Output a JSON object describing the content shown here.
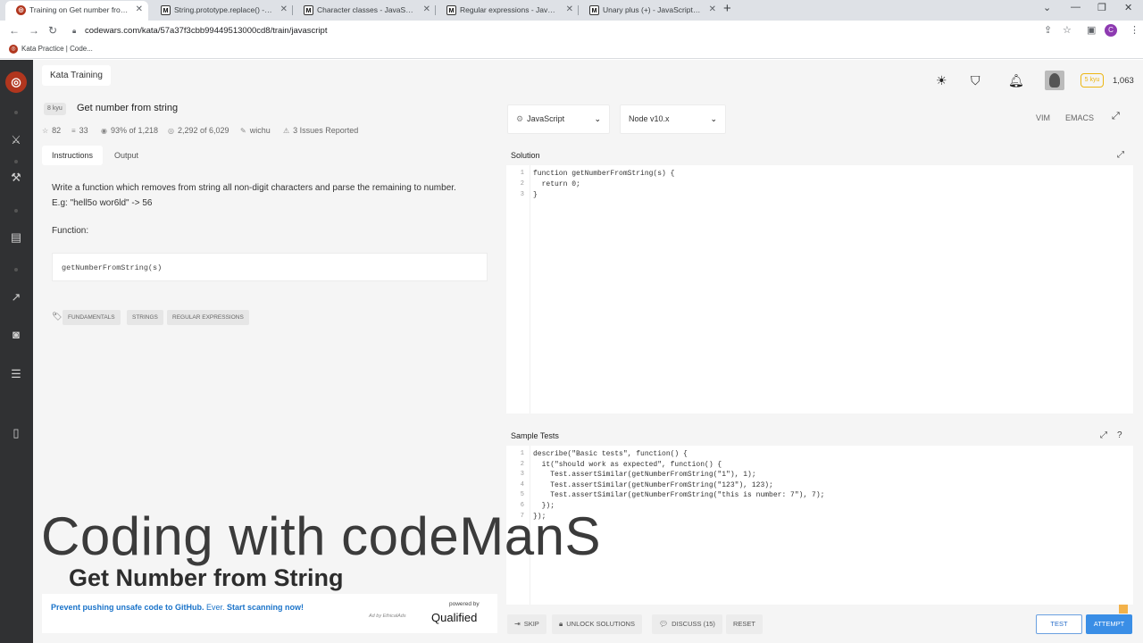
{
  "browser": {
    "tabs": [
      {
        "title": "Training on Get number from str",
        "favicon": "codewars-icon",
        "active": true
      },
      {
        "title": "String.prototype.replace() - JavaS",
        "favicon": "mdn-icon",
        "active": false
      },
      {
        "title": "Character classes - JavaScript | M",
        "favicon": "mdn-icon",
        "active": false
      },
      {
        "title": "Regular expressions - JavaScript",
        "favicon": "mdn-icon",
        "active": false
      },
      {
        "title": "Unary plus (+) - JavaScript | MDN",
        "favicon": "mdn-icon",
        "active": false
      }
    ],
    "url": "codewars.com/kata/57a37f3cbb99449513000cd8/train/javascript",
    "bookmark": "Kata Practice | Code...",
    "profile_initial": "C"
  },
  "breadcrumb": "Kata Training",
  "header": {
    "honor": "1,063",
    "rank_badge": "5 kyu"
  },
  "kata": {
    "rank": "8 kyu",
    "title": "Get number from string",
    "stats": {
      "stars": "82",
      "collections": "33",
      "satisfaction": "93%",
      "satisfaction_of": "of 1,218",
      "completed": "2,292",
      "completed_of": "of 6,029",
      "author": "wichu",
      "issues": "3 Issues Reported"
    },
    "tabs": [
      "Instructions",
      "Output"
    ],
    "description_line1": "Write a function which removes from string all non-digit characters and parse the remaining to number.",
    "description_line2": "E.g: \"hell5o wor6ld\" -> 56",
    "function_label": "Function:",
    "function_signature": "getNumberFromString(s)",
    "tags": [
      "FUNDAMENTALS",
      "STRINGS",
      "REGULAR EXPRESSIONS"
    ]
  },
  "ad": {
    "text_bold1": "Prevent pushing unsafe code to GitHub.",
    "text_normal": " Ever. ",
    "text_bold2": "Start scanning now!",
    "note": "Ad by EthicalAds",
    "powered": "powered by",
    "brand": "Qualified"
  },
  "editor": {
    "language": "JavaScript",
    "runtime": "Node v10.x",
    "mode_vim": "VIM",
    "mode_emacs": "EMACS",
    "solution_title": "Solution",
    "solution_lines": [
      "function getNumberFromString(s) {",
      "  return 0;",
      "}"
    ],
    "tests_title": "Sample Tests",
    "test_lines": [
      "describe(\"Basic tests\", function() {",
      "  it(\"should work as expected\", function() {",
      "    Test.assertSimilar(getNumberFromString(\"1\"), 1);",
      "    Test.assertSimilar(getNumberFromString(\"123\"), 123);",
      "    Test.assertSimilar(getNumberFromString(\"this is number: 7\"), 7);",
      "  });",
      "});"
    ]
  },
  "actions": {
    "skip": "SKIP",
    "unlock": "UNLOCK SOLUTIONS",
    "discuss": "DISCUSS (15)",
    "reset": "RESET",
    "test": "TEST",
    "attempt": "ATTEMPT"
  },
  "overlay": {
    "title": "Coding with codeManS",
    "subtitle": "Get Number from String"
  }
}
